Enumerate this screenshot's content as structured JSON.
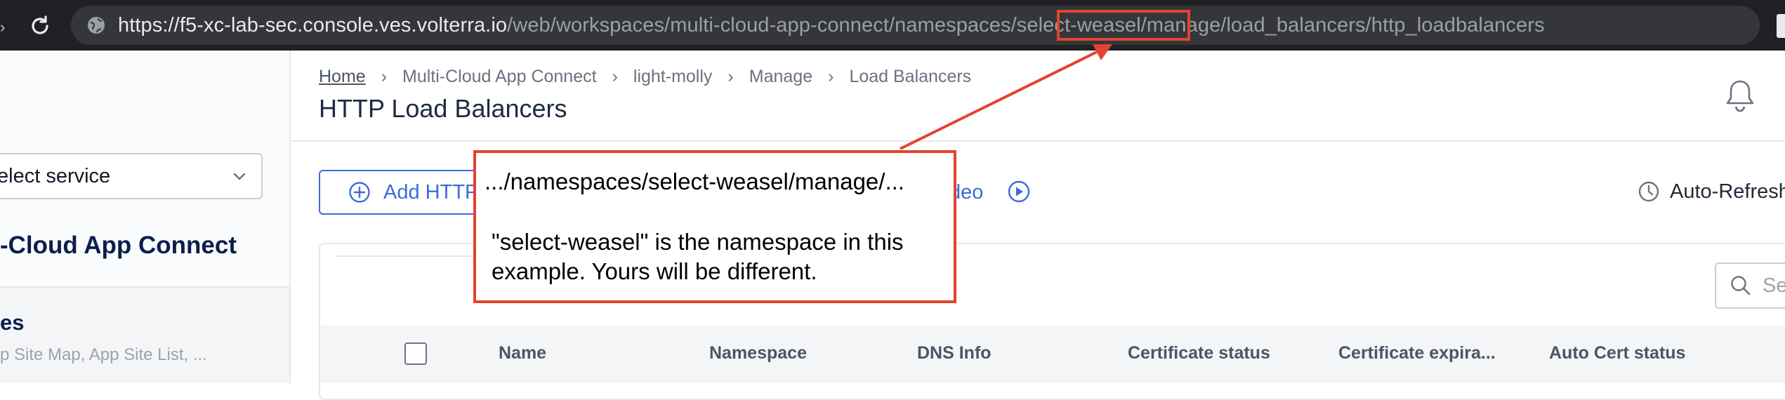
{
  "browser": {
    "url_host": "https://f5-xc-lab-sec.console.ves.volterra.io",
    "url_path_a": "/web/workspaces/multi-cloud-app-connect/namespaces/",
    "url_path_ns": "select-weasel",
    "url_path_b": "/manage/load_balancers/http_loadbalancers"
  },
  "sidebar": {
    "service_select_label": "elect service",
    "app_title": "-Cloud App Connect",
    "item_title": "es",
    "item_subtitle": "p Site Map, App Site List, ..."
  },
  "header": {
    "breadcrumb": [
      "Home",
      "Multi-Cloud App Connect",
      "light-molly",
      "Manage",
      "Load Balancers"
    ],
    "title": "HTTP Load Balancers"
  },
  "toolbar": {
    "add_label": "Add HTTP",
    "video_label": "deo",
    "autorefresh_label": "Auto-Refresh"
  },
  "table": {
    "search_placeholder": "Se",
    "columns": [
      "Name",
      "Namespace",
      "DNS Info",
      "Certificate status",
      "Certificate expira...",
      "Auto Cert status"
    ]
  },
  "annotation": {
    "line1": ".../namespaces/select-weasel/manage/...",
    "para": "\"select-weasel\" is the namespace in this example. Yours will be different.",
    "color": "#e2442f"
  },
  "colors": {
    "accent": "#3b6bdc",
    "chrome_bg": "#202124",
    "urlbar_bg": "#35363a"
  }
}
